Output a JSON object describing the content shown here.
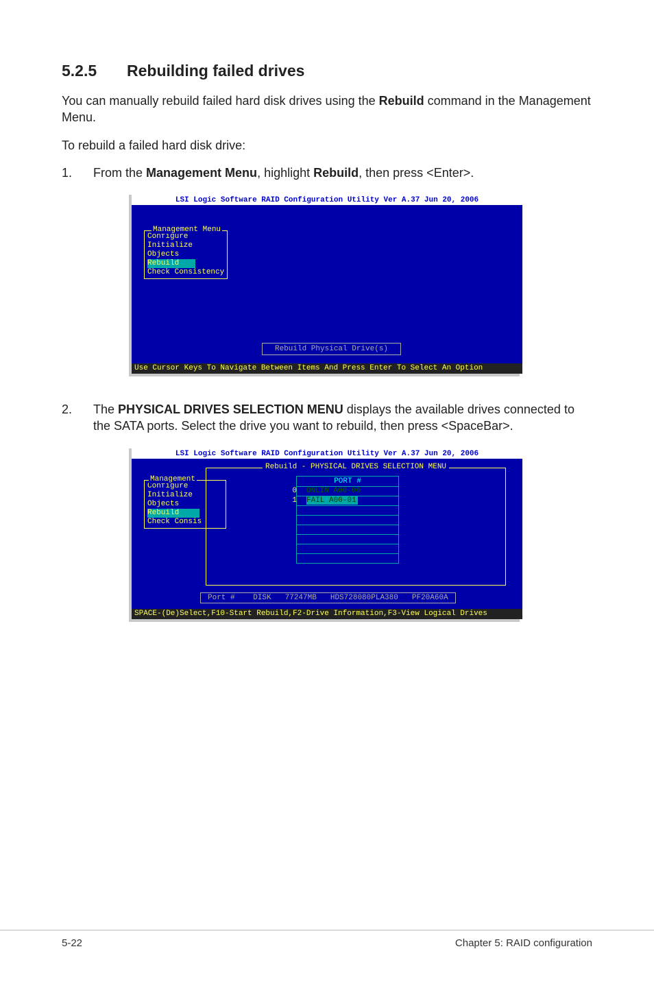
{
  "heading": {
    "number": "5.2.5",
    "title": "Rebuilding failed drives"
  },
  "intro": {
    "pre": "You can manually rebuild failed hard disk drives using the ",
    "bold": "Rebuild",
    "post": " command in the Management Menu."
  },
  "lead": "To rebuild a failed hard disk drive:",
  "step1": {
    "num": "1.",
    "frag1": "From the ",
    "bold1": "Management Menu",
    "frag2": ", highlight ",
    "bold2": "Rebuild",
    "frag3": ", then press <Enter>."
  },
  "bios": {
    "title": "LSI Logic Software RAID Configuration Utility Ver A.37 Jun 20, 2006",
    "mgmt_legend": "Management Menu",
    "items": {
      "configure": "Configure",
      "initialize": "Initialize",
      "objects": "Objects",
      "rebuild": "Rebuild",
      "check": "Check Consistency"
    },
    "phys_box": "Rebuild Physical Drive(s)",
    "hint": "Use Cursor Keys To Navigate Between Items And Press Enter To Select An Option"
  },
  "step2": {
    "num": "2.",
    "frag1": "The ",
    "bold1": "PHYSICAL DRIVES SELECTION MENU",
    "frag2": " displays the available drives connected to the SATA ports. Select the drive you want to rebuild, then press <SpaceBar>."
  },
  "bios2": {
    "title": "LSI Logic Software RAID Configuration Utility Ver A.37 Jun 20, 2006",
    "panel_legend": "Rebuild - PHYSICAL DRIVES SELECTION MENU",
    "mgmt_trunc": "Management",
    "items_trunc": {
      "configure": "Configure",
      "initialize": "Initialize",
      "objects": "Objects",
      "rebuild": "Rebuild",
      "check": "Check Consis"
    },
    "port_hdr": "PORT #",
    "port0_idx": "0",
    "port0_val": "ONLIN A00-00",
    "port1_idx": "1",
    "port1_val": "FAIL  A00-01",
    "drive_info": {
      "port": "Port #",
      "disk": "  DISK",
      "size": "77247MB",
      "model": "HDS728080PLA380",
      "fw": "PF20A60A"
    },
    "hint": "SPACE-(De)Select,F10-Start Rebuild,F2-Drive Information,F3-View Logical Drives"
  },
  "footer": {
    "left": "5-22",
    "right": "Chapter 5: RAID configuration"
  }
}
